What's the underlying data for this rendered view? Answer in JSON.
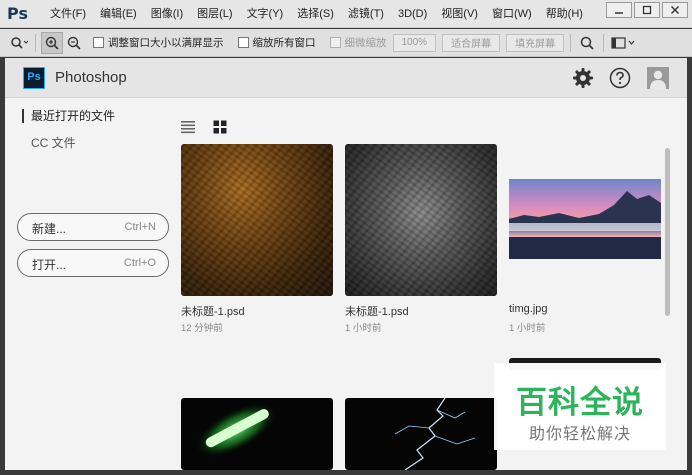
{
  "menubar": {
    "logo": "Ps",
    "items": [
      "文件(F)",
      "编辑(E)",
      "图像(I)",
      "图层(L)",
      "文字(Y)",
      "选择(S)",
      "滤镜(T)",
      "3D(D)",
      "视图(V)",
      "窗口(W)",
      "帮助(H)"
    ]
  },
  "options": {
    "resize_windows": "调整窗口大小以满屏显示",
    "zoom_all": "缩放所有窗口",
    "scrubby_zoom": "细微缩放",
    "percent": "100%",
    "fit_screen": "适合屏幕",
    "fill_screen": "填充屏幕"
  },
  "header": {
    "badge": "Ps",
    "app_name": "Photoshop"
  },
  "sidebar": {
    "recent": "最近打开的文件",
    "cc_files": "CC 文件",
    "new_label": "新建...",
    "new_shortcut": "Ctrl+N",
    "open_label": "打开...",
    "open_shortcut": "Ctrl+O"
  },
  "files": [
    {
      "name": "未标题-1.psd",
      "time": "12 分钟前"
    },
    {
      "name": "未标题-1.psd",
      "time": "1 小时前"
    },
    {
      "name": "timg.jpg",
      "time": "1 小时前"
    }
  ],
  "watermark": {
    "main": "百科全说",
    "sub": "助你轻松解决"
  },
  "colors": {
    "accent_green": "#2bb45a",
    "ps_blue": "#31a8ff",
    "ps_dark": "#0a1d2e"
  }
}
